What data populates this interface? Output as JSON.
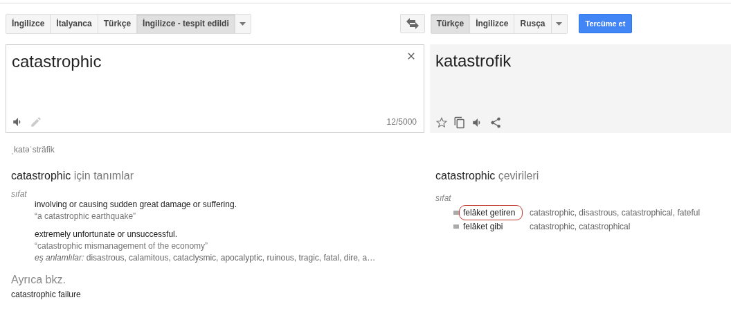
{
  "source_languages": [
    {
      "label": "İngilizce",
      "selected": false
    },
    {
      "label": "İtalyanca",
      "selected": false
    },
    {
      "label": "Türkçe",
      "selected": false
    },
    {
      "label": "İngilizce - tespit edildi",
      "selected": true
    }
  ],
  "target_languages": [
    {
      "label": "Türkçe",
      "selected": true
    },
    {
      "label": "İngilizce",
      "selected": false
    },
    {
      "label": "Rusça",
      "selected": false
    }
  ],
  "translate_button": "Tercüme et",
  "source": {
    "value": "catastrophic",
    "counter": "12/5000"
  },
  "target": {
    "value": "katastrofik"
  },
  "phonetic": "ˌkatəˈsträfik",
  "definitions": {
    "term": "catastrophic",
    "label": "için tanımlar",
    "part_of_speech": "sıfat",
    "entries": [
      {
        "meaning": "involving or causing sudden great damage or suffering.",
        "example": "“a catastrophic earthquake”"
      },
      {
        "meaning": "extremely unfortunate or unsuccessful.",
        "example": "“catastrophic mismanagement of the economy”",
        "synonyms": "*eş anlamlılar:* disastrous, calamitous, cataclysmic, apocalyptic, ruinous, tragic, fatal, dire, a…"
      }
    ]
  },
  "see_also": {
    "title": "Ayrıca bkz.",
    "items": [
      "catastrophic failure"
    ]
  },
  "translations": {
    "term": "catastrophic",
    "label": "çevirileri",
    "part_of_speech": "sıfat",
    "rows": [
      {
        "word": "felâket getiren",
        "synonyms": "catastrophic, disastrous, catastrophical, fateful",
        "circled": true
      },
      {
        "word": "felâket gibi",
        "synonyms": "catastrophic, catastrophical",
        "circled": false
      }
    ]
  }
}
